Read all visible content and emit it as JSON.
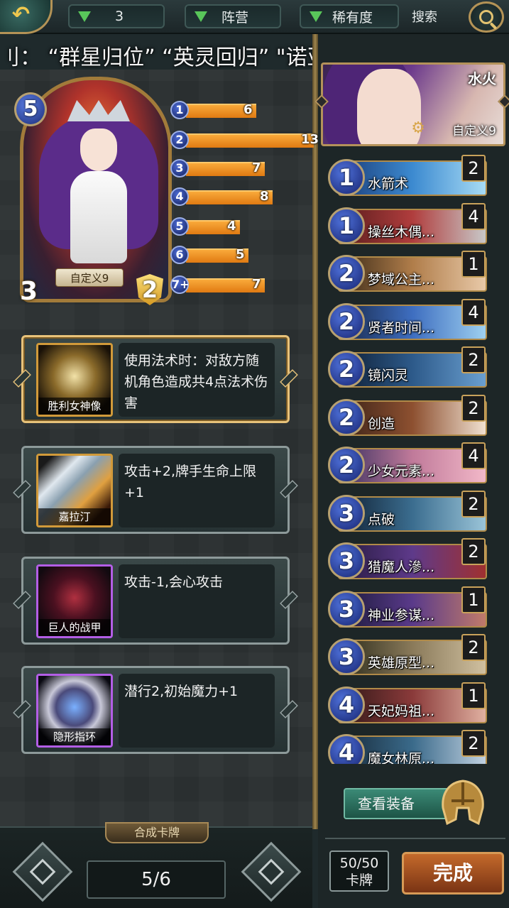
{
  "topbar": {
    "back_icon": "back-arrow-icon",
    "filter_cost": "3",
    "filter_faction": "阵营",
    "filter_rarity": "稀有度",
    "search_label": "搜索",
    "search_icon": "magnifier-icon"
  },
  "marquee": {
    "text": "刂：  “群星归位”  “英灵回归” \"诺亚方舟\""
  },
  "hero": {
    "name": "自定义9",
    "cost": "5",
    "attack": "3",
    "health": "2"
  },
  "cost_curve": [
    {
      "cost": "1",
      "count": 6
    },
    {
      "cost": "2",
      "count": 13
    },
    {
      "cost": "3",
      "count": 7
    },
    {
      "cost": "4",
      "count": 8
    },
    {
      "cost": "5",
      "count": 4
    },
    {
      "cost": "6",
      "count": 5
    },
    {
      "cost": "7+",
      "count": 7
    }
  ],
  "equipment": [
    {
      "name": "胜利女神像",
      "desc": "使用法术时：对敌方随机角色造成共4点法术伤害",
      "selected": true,
      "rarity_color": "#d19a3a"
    },
    {
      "name": "嘉拉汀",
      "desc": "攻击+2,牌手生命上限+1",
      "selected": false,
      "rarity_color": "#d19a3a"
    },
    {
      "name": "巨人的战甲",
      "desc": "攻击-1,会心攻击",
      "selected": false,
      "rarity_color": "#b35ee6"
    },
    {
      "name": "隐形指环",
      "desc": "潜行2,初始魔力+1",
      "selected": false,
      "rarity_color": "#b35ee6"
    }
  ],
  "bottom_left": {
    "synth_tab": "合成卡牌",
    "page": "5/6"
  },
  "deck_header": {
    "element": "水火",
    "name": "自定义9"
  },
  "deck": [
    {
      "cost": "1",
      "name": "水箭术",
      "count": "2",
      "bg": "linear-gradient(90deg,#1b3c78,#3c8ad0,#a7dbf5)"
    },
    {
      "cost": "1",
      "name": "操丝木偶...",
      "count": "4",
      "bg": "linear-gradient(90deg,#5a1d1d,#b03d3d,#c8c8c8)"
    },
    {
      "cost": "2",
      "name": "梦域公主...",
      "count": "1",
      "bg": "linear-gradient(90deg,#3a2a18,#b07d4a,#e8c9a8)"
    },
    {
      "cost": "2",
      "name": "贤者时间...",
      "count": "4",
      "bg": "linear-gradient(90deg,#18284a,#3e6ec0,#9ed0f0)"
    },
    {
      "cost": "2",
      "name": "镜闪灵",
      "count": "2",
      "bg": "linear-gradient(90deg,#0e1e34,#2d5a8a,#6a9fd0)"
    },
    {
      "cost": "2",
      "name": "创造",
      "count": "2",
      "bg": "linear-gradient(90deg,#3a2218,#8d5030,#f0e0d0)"
    },
    {
      "cost": "2",
      "name": "少女元素...",
      "count": "4",
      "bg": "linear-gradient(90deg,#3a3060,#c07a9a,#f2b8c8)"
    },
    {
      "cost": "3",
      "name": "点破",
      "count": "2",
      "bg": "linear-gradient(90deg,#102033,#3b6d8f,#9ac4d8)"
    },
    {
      "cost": "3",
      "name": "猎魔人滲...",
      "count": "2",
      "bg": "linear-gradient(90deg,#261a40,#5e3a8a,#a03030)"
    },
    {
      "cost": "3",
      "name": "神业参谋...",
      "count": "1",
      "bg": "linear-gradient(90deg,#1a1a3a,#5a3a8a,#c07a6a)"
    },
    {
      "cost": "3",
      "name": "英雄原型...",
      "count": "2",
      "bg": "linear-gradient(90deg,#2a2a1a,#8a7a5a,#d0c0a0)"
    },
    {
      "cost": "4",
      "name": "天妃妈祖...",
      "count": "1",
      "bg": "linear-gradient(90deg,#301818,#8a3a3a,#e0b0a0)"
    },
    {
      "cost": "4",
      "name": "魔女林原...",
      "count": "2",
      "bg": "linear-gradient(90deg,#182a3a,#3a6a8a,#c0d0e0)"
    }
  ],
  "right_bottom": {
    "view_equip": "查看装备",
    "deck_count_line1": "50/50",
    "deck_count_line2": "卡牌",
    "done": "完成",
    "helmet_icon": "helmet-icon"
  }
}
